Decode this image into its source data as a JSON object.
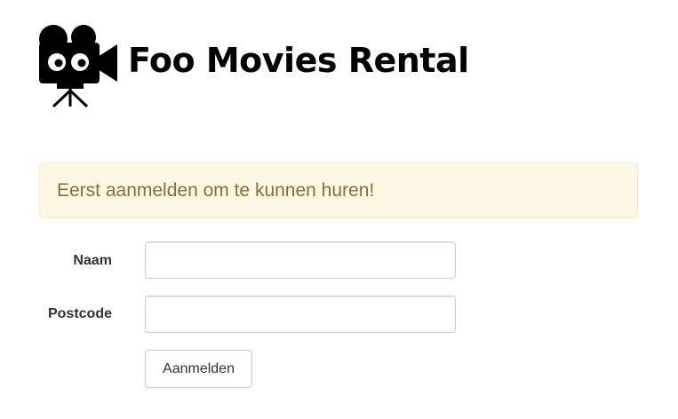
{
  "header": {
    "logo_icon": "movie-camera-icon",
    "title": "Foo Movies Rental"
  },
  "alert": {
    "message": "Eerst aanmelden om te kunnen huren!",
    "background": "#fcf8e3",
    "text_color": "#8a6d3b"
  },
  "form": {
    "naam_label": "Naam",
    "naam_value": "",
    "postcode_label": "Postcode",
    "postcode_value": "",
    "submit_label": "Aanmelden"
  }
}
